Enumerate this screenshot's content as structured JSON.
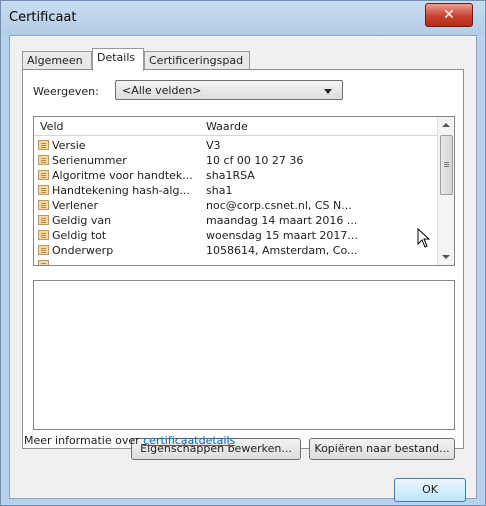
{
  "window": {
    "title": "Certificaat"
  },
  "tabs": [
    {
      "label": "Algemeen",
      "active": false
    },
    {
      "label": "Details",
      "active": true
    },
    {
      "label": "Certificeringspad",
      "active": false
    }
  ],
  "show": {
    "label": "Weergeven:",
    "selected": "<Alle velden>"
  },
  "list": {
    "columns": [
      "Veld",
      "Waarde"
    ],
    "rows": [
      {
        "field": "Versie",
        "value": "V3"
      },
      {
        "field": "Serienummer",
        "value": "10 cf 00 10 27 36"
      },
      {
        "field": "Algoritme voor handtek...",
        "value": "sha1RSA"
      },
      {
        "field": "Handtekening hash-alg...",
        "value": "sha1"
      },
      {
        "field": "Verlener",
        "value": "noc@corp.csnet.nl, CS N..."
      },
      {
        "field": "Geldig van",
        "value": "maandag 14 maart 2016 ..."
      },
      {
        "field": "Geldig tot",
        "value": "woensdag 15 maart 2017..."
      },
      {
        "field": "Onderwerp",
        "value": "1058614, Amsterdam, Co..."
      }
    ]
  },
  "buttons": {
    "edit_properties": "Eigenschappen bewerken...",
    "copy_to_file": "Kopiëren naar bestand...",
    "ok": "OK"
  },
  "more_info": {
    "prefix": "Meer informatie over ",
    "link": "certificaatdetails"
  },
  "colors": {
    "frame": "#b9d1ea",
    "close": "#c7432f",
    "link": "#0066cc"
  }
}
